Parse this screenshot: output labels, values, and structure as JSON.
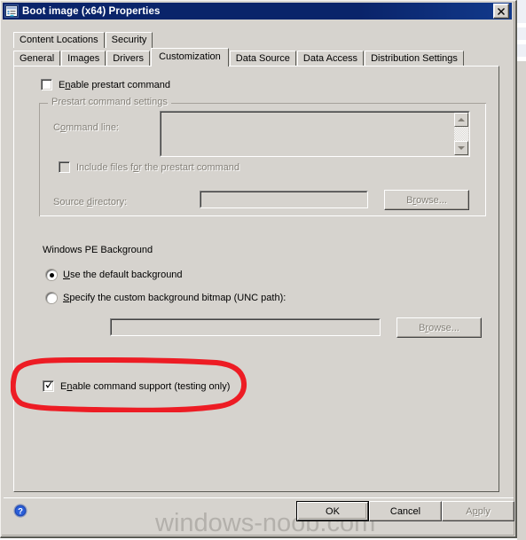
{
  "window": {
    "title": "Boot image (x64) Properties",
    "icon": "properties-window-icon",
    "close_label": "✕"
  },
  "tabs": {
    "row_top": [
      {
        "label": "Content Locations",
        "selected": false
      },
      {
        "label": "Security",
        "selected": false
      }
    ],
    "row_bottom": [
      {
        "label": "General",
        "selected": false
      },
      {
        "label": "Images",
        "selected": false
      },
      {
        "label": "Drivers",
        "selected": false
      },
      {
        "label": "Customization",
        "selected": true
      },
      {
        "label": "Data Source",
        "selected": false
      },
      {
        "label": "Data Access",
        "selected": false
      },
      {
        "label": "Distribution Settings",
        "selected": false
      }
    ]
  },
  "customization": {
    "enable_prestart": {
      "label_pre": "E",
      "label_acc": "n",
      "label_post": "able prestart command",
      "checked": false,
      "enabled": true
    },
    "prestart_group": {
      "title": "Prestart command settings",
      "enabled": false,
      "command_line": {
        "label_pre": "C",
        "label_acc": "o",
        "label_post": "mmand line:",
        "value": "",
        "scrollbar": true
      },
      "include_files": {
        "label_pre": "Include files f",
        "label_acc": "o",
        "label_post": "r the prestart command",
        "checked": false
      },
      "source_directory": {
        "label_pre": "Source ",
        "label_acc": "d",
        "label_post": "irectory:",
        "value": ""
      },
      "browse_button": {
        "label_pre": "B",
        "label_acc": "r",
        "label_post": "owse...",
        "enabled": false
      }
    },
    "winpe_background": {
      "heading": "Windows PE Background",
      "selected_option": "default",
      "option_default": {
        "label_pre": "",
        "label_acc": "U",
        "label_post": "se the default background"
      },
      "option_custom": {
        "label_pre": "",
        "label_acc": "S",
        "label_post": "pecify the custom background bitmap (UNC path):"
      },
      "custom_path": {
        "value": ""
      },
      "browse_button": {
        "label_pre": "B",
        "label_acc": "r",
        "label_post": "owse...",
        "enabled": false
      }
    },
    "enable_command_support": {
      "label_pre": "E",
      "label_acc": "n",
      "label_post": "able command support (testing only)",
      "checked": true,
      "enabled": true,
      "annotated": true,
      "annotation_color": "#ED1C24"
    }
  },
  "footer": {
    "help_icon": "help-question-icon",
    "ok": {
      "label": "OK",
      "enabled": true,
      "default": true
    },
    "cancel": {
      "label": "Cancel",
      "enabled": true,
      "default": false
    },
    "apply": {
      "label_pre": "A",
      "label_acc": "p",
      "label_post": "ply",
      "enabled": false,
      "default": false
    }
  },
  "watermark": {
    "text": "windows-noob.com",
    "color": "#b3b0ab"
  },
  "theme": {
    "dialog_face": "#d6d3ce",
    "titlebar": "#0a246a",
    "titlebar_text": "#ffffff",
    "disabled_text": "#848078",
    "accent_red": "#ED1C24"
  }
}
